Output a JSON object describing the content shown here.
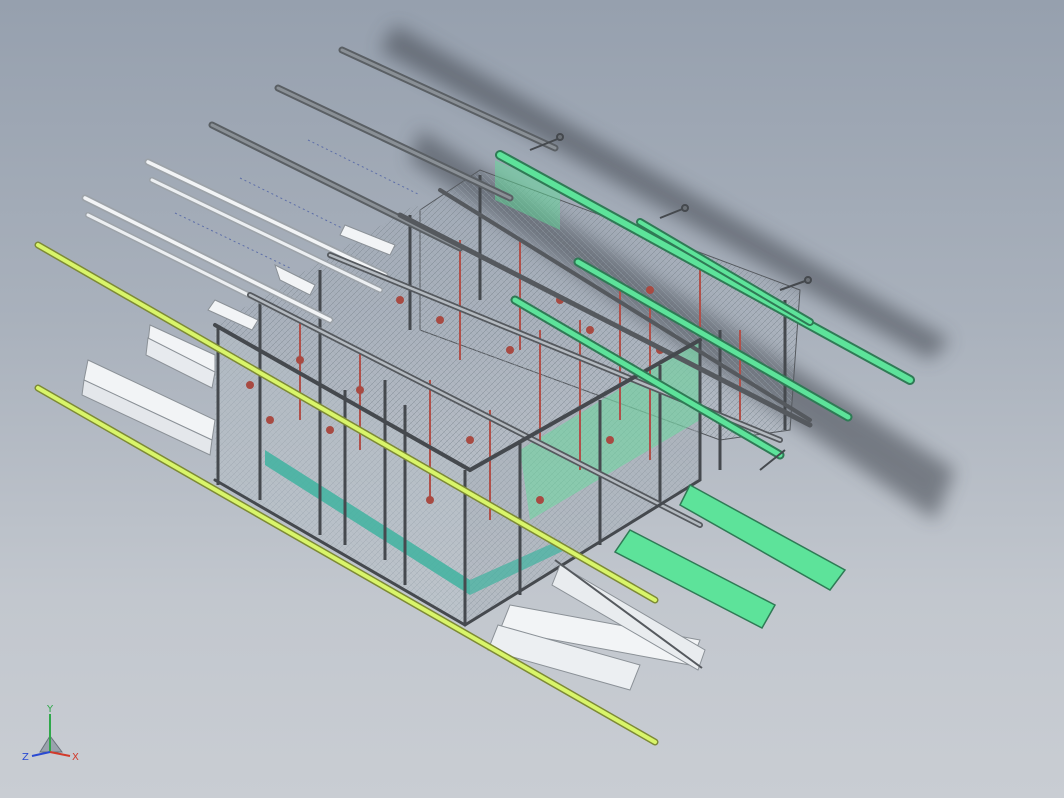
{
  "viewport": {
    "background_top": "#96a0ae",
    "background_bottom": "#c9cdd3"
  },
  "model": {
    "frame_color": "#4a4d52",
    "mesh_color": "#8f9aa3",
    "highlight_green": "#5de39a",
    "highlight_yellow": "#d9f56a",
    "channel_white": "#f2f4f6",
    "channel_gray": "#9aa0a6",
    "rebar_red": "#b0504a",
    "base_teal": "#3fb3a0"
  },
  "triad": {
    "x_label": "X",
    "y_label": "Y",
    "z_label": "Z",
    "x_color": "#d23a2a",
    "y_color": "#2fa84a",
    "z_color": "#2a4ad2"
  }
}
